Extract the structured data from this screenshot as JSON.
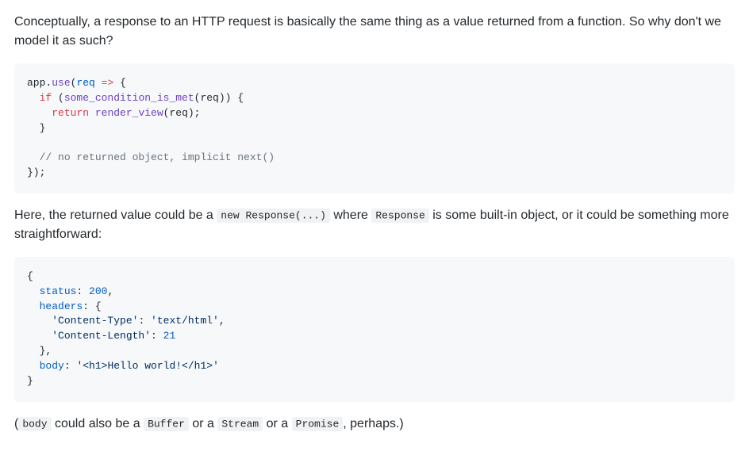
{
  "para1": "Conceptually, a response to an HTTP request is basically the same thing as a value returned from a function. So why don't we model it as such?",
  "code1": {
    "l1a": "app.",
    "l1b": "use",
    "l1c": "(",
    "l1d": "req",
    "l1e": " ",
    "l1f": "=>",
    "l1g": " {",
    "l2a": "  ",
    "l2b": "if",
    "l2c": " (",
    "l2d": "some_condition_is_met",
    "l2e": "(req)) {",
    "l3a": "    ",
    "l3b": "return",
    "l3c": " ",
    "l3d": "render_view",
    "l3e": "(req);",
    "l4": "  }",
    "l5": "",
    "l6a": "  ",
    "l6b": "// no returned object, implicit next()",
    "l7": "});"
  },
  "para2a": "Here, the returned value could be a ",
  "para2b": "new Response(...)",
  "para2c": " where ",
  "para2d": "Response",
  "para2e": " is some built-in object, or it could be something more straightforward:",
  "code2": {
    "l1": "{",
    "l2a": "  ",
    "l2b": "status",
    "l2c": ": ",
    "l2d": "200",
    "l2e": ",",
    "l3a": "  ",
    "l3b": "headers",
    "l3c": ": {",
    "l4a": "    ",
    "l4b": "'Content-Type'",
    "l4c": ": ",
    "l4d": "'text/html'",
    "l4e": ",",
    "l5a": "    ",
    "l5b": "'Content-Length'",
    "l5c": ": ",
    "l5d": "21",
    "l6": "  },",
    "l7a": "  ",
    "l7b": "body",
    "l7c": ": ",
    "l7d": "'<h1>Hello world!</h1>'",
    "l8": "}"
  },
  "para3a": "(",
  "para3b": "body",
  "para3c": " could also be a ",
  "para3d": "Buffer",
  "para3e": " or a ",
  "para3f": "Stream",
  "para3g": " or a ",
  "para3h": "Promise",
  "para3i": ", perhaps.)"
}
